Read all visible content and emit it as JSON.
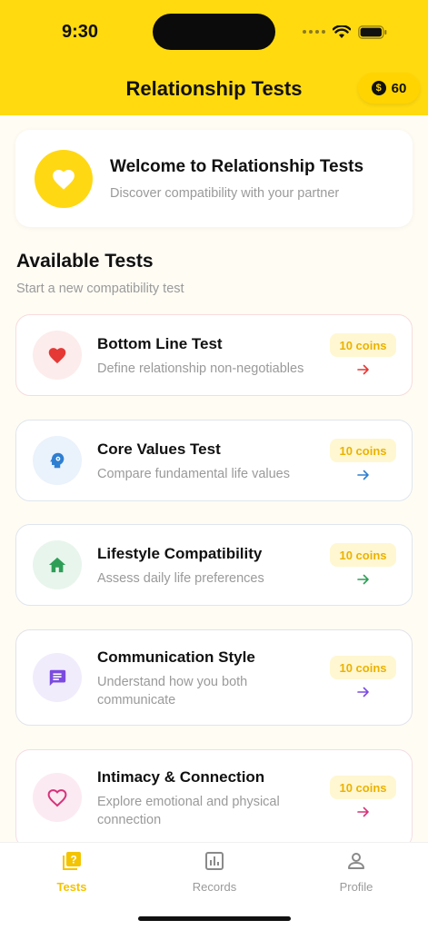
{
  "status_bar": {
    "time": "9:30"
  },
  "header": {
    "title": "Relationship Tests",
    "coins": "60",
    "coin_symbol": "$"
  },
  "welcome": {
    "title": "Welcome to Relationship Tests",
    "subtitle": "Discover compatibility with your partner",
    "icon": "heart-icon"
  },
  "section": {
    "title": "Available Tests",
    "subtitle": "Start a new compatibility test"
  },
  "tests": [
    {
      "title": "Bottom Line Test",
      "description": "Define relationship non-negotiables",
      "cost": "10 coins",
      "icon": "heart-icon",
      "color": "#E53935",
      "bg": "#FDECEC"
    },
    {
      "title": "Core Values Test",
      "description": "Compare fundamental life values",
      "cost": "10 coins",
      "icon": "brain-head-icon",
      "color": "#2F7FD1",
      "bg": "#EAF2FB"
    },
    {
      "title": "Lifestyle Compatibility",
      "description": "Assess daily life preferences",
      "cost": "10 coins",
      "icon": "home-icon",
      "color": "#2E9E57",
      "bg": "#E8F5EC"
    },
    {
      "title": "Communication Style",
      "description": "Understand how you both communicate",
      "cost": "10 coins",
      "icon": "message-icon",
      "color": "#7B4BE0",
      "bg": "#F1ECFC"
    },
    {
      "title": "Intimacy & Connection",
      "description": "Explore emotional and physical connection",
      "cost": "10 coins",
      "icon": "heart-outline-icon",
      "color": "#D6337A",
      "bg": "#FCEAF2"
    }
  ],
  "tabbar": {
    "tabs": [
      {
        "label": "Tests",
        "icon": "quiz-icon",
        "active": true
      },
      {
        "label": "Records",
        "icon": "bar-chart-icon",
        "active": false
      },
      {
        "label": "Profile",
        "icon": "person-icon",
        "active": false
      }
    ]
  },
  "colors": {
    "brand_yellow": "#FFDA0F",
    "badge_text": "#EBB200"
  }
}
